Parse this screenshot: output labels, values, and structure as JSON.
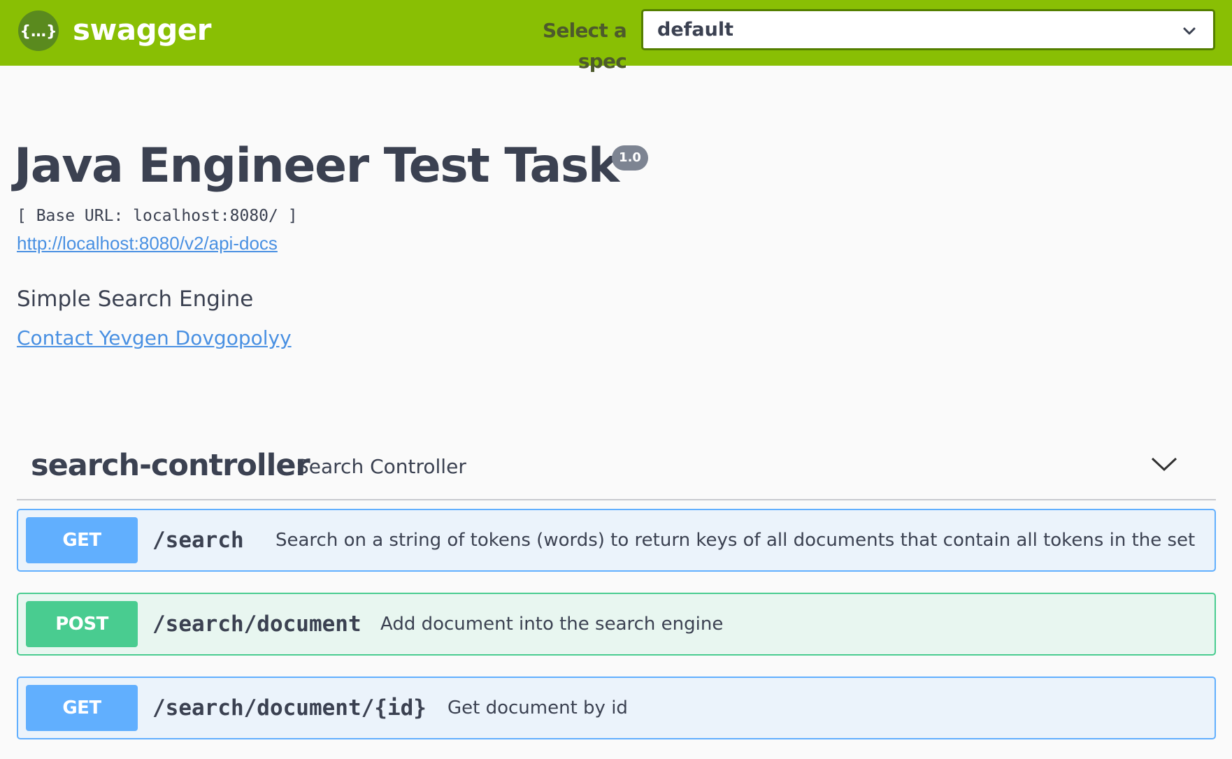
{
  "topbar": {
    "logo_icon": "swagger-braces-icon",
    "logo_glyph": "{…}",
    "brand": "swagger",
    "spec_label": "Select a spec",
    "spec_selected": "default",
    "colors": {
      "bar": "#89bf04",
      "logo": "#5a8a1e",
      "select_border": "#547f00"
    }
  },
  "info": {
    "title": "Java Engineer Test Task",
    "version": "1.0",
    "base_url": "[ Base URL: localhost:8080/ ]",
    "api_docs_link": "http://localhost:8080/v2/api-docs",
    "description": "Simple Search Engine",
    "contact": "Contact Yevgen Dovgopolyy"
  },
  "controller": {
    "name": "search-controller",
    "description": "Search Controller",
    "toggle_icon": "chevron-down-icon",
    "operations": [
      {
        "method": "GET",
        "path": "/search",
        "summary": "Search on a string of tokens (words) to return keys of all documents that contain all tokens in the set",
        "color": "#61affe"
      },
      {
        "method": "POST",
        "path": "/search/document",
        "summary": "Add document into the search engine",
        "color": "#49cc90"
      },
      {
        "method": "GET",
        "path": "/search/document/{id}",
        "summary": "Get document by id",
        "color": "#61affe"
      }
    ]
  }
}
